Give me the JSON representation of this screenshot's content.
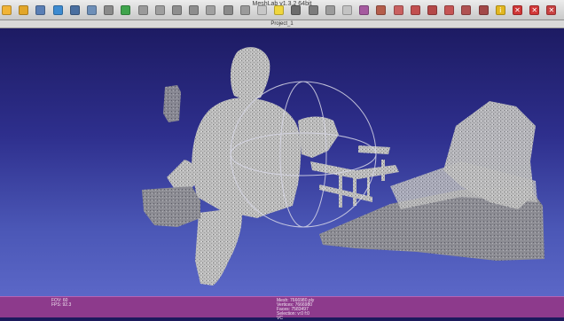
{
  "window": {
    "title": "MeshLab v1.3.2 64bit"
  },
  "document": {
    "title": "Project_1"
  },
  "toolbar": {
    "icons": [
      {
        "name": "new-project-icon",
        "color": "#f1b436",
        "glyph": ""
      },
      {
        "name": "open-project-icon",
        "color": "#e2a629",
        "glyph": ""
      },
      {
        "name": "save-project-icon",
        "color": "#5a7fb5",
        "glyph": ""
      },
      {
        "name": "import-mesh-icon",
        "color": "#3d8bd1",
        "glyph": ""
      },
      {
        "name": "export-mesh-icon",
        "color": "#4a6fa0",
        "glyph": ""
      },
      {
        "name": "reload-icon",
        "color": "#6e8fb8",
        "glyph": ""
      },
      {
        "name": "snapshot-icon",
        "color": "#8a8a8a",
        "glyph": ""
      },
      {
        "name": "close-mesh-icon",
        "color": "#3fa44c",
        "glyph": ""
      },
      {
        "name": "bounding-box-icon",
        "color": "#9a9a9a",
        "glyph": ""
      },
      {
        "name": "points-icon",
        "color": "#9e9e9e",
        "glyph": ""
      },
      {
        "name": "wireframe-icon",
        "color": "#8e8e8e",
        "glyph": ""
      },
      {
        "name": "hidden-lines-icon",
        "color": "#8d8d8d",
        "glyph": ""
      },
      {
        "name": "flat-lines-icon",
        "color": "#a0a0a0",
        "glyph": ""
      },
      {
        "name": "flat-shading-icon",
        "color": "#8a8a8a",
        "glyph": ""
      },
      {
        "name": "smooth-shading-icon",
        "color": "#9a9a9a",
        "glyph": ""
      },
      {
        "name": "texture-icon",
        "color": "#c7c7c7",
        "glyph": ""
      },
      {
        "name": "light-bulb-icon",
        "color": "#efd63e",
        "glyph": ""
      },
      {
        "name": "double-side-lighting-icon",
        "color": "#6c6c6c",
        "glyph": ""
      },
      {
        "name": "fancy-lighting-icon",
        "color": "#7c7c7c",
        "glyph": ""
      },
      {
        "name": "backface-culling-icon",
        "color": "#9b9b9b",
        "glyph": ""
      },
      {
        "name": "color-per-vertex-icon",
        "color": "#c3c3c3",
        "glyph": ""
      },
      {
        "name": "color-per-face-icon",
        "color": "#a55a9f",
        "glyph": ""
      },
      {
        "name": "paint-brush-icon",
        "color": "#b45d4b",
        "glyph": ""
      },
      {
        "name": "measuring-tool-icon",
        "color": "#c96060",
        "glyph": ""
      },
      {
        "name": "select-faces-icon",
        "color": "#c24f4f",
        "glyph": ""
      },
      {
        "name": "select-vertices-icon",
        "color": "#b44848",
        "glyph": ""
      },
      {
        "name": "select-connected-icon",
        "color": "#c55454",
        "glyph": ""
      },
      {
        "name": "align-tool-icon",
        "color": "#b05252",
        "glyph": ""
      },
      {
        "name": "manipulator-icon",
        "color": "#a24848",
        "glyph": ""
      },
      {
        "name": "info-icon",
        "color": "#e2b71f",
        "glyph": "i"
      },
      {
        "name": "delete-selected-faces-icon",
        "color": "#cf3636",
        "glyph": "✕"
      },
      {
        "name": "delete-selected-vertices-icon",
        "color": "#d23838",
        "glyph": "✕"
      },
      {
        "name": "delete-selection-icon",
        "color": "#c84040",
        "glyph": "✕"
      }
    ]
  },
  "viewport": {
    "colors": {
      "top": "#1d1b63",
      "bottom": "#5b67c7",
      "mesh": "#c9c9c9",
      "trackball": "#d9d9e8"
    }
  },
  "status": {
    "left": [
      "FOV: 60",
      "FPS: 92.3"
    ],
    "center": [
      "Mesh: 7666980.ply",
      "Vertices: 7666980",
      "Faces: 7583497",
      "Selection: v:0 f:0",
      "VC"
    ],
    "colors": {
      "bar": "#8d3a8c"
    }
  }
}
